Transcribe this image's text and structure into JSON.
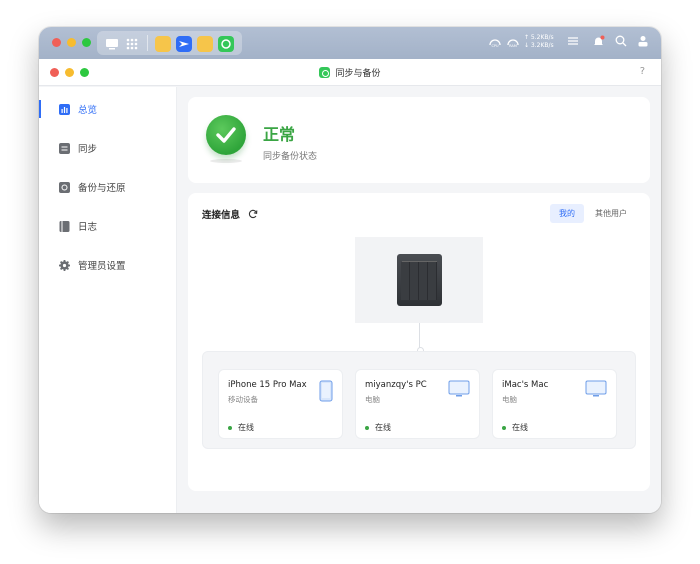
{
  "window": {
    "title": "同步与备份",
    "help": "?"
  },
  "systembar": {
    "net_up": "↑ 5.2KB/s",
    "net_down": "↓ 3.2KB/s",
    "cpu_label": "CPU",
    "ram_label": "RAM"
  },
  "sidebar": {
    "items": [
      {
        "label": "总览",
        "icon": "overview-icon",
        "active": true
      },
      {
        "label": "同步",
        "icon": "sync-icon",
        "active": false
      },
      {
        "label": "备份与还原",
        "icon": "backup-restore-icon",
        "active": false
      },
      {
        "label": "日志",
        "icon": "log-icon",
        "active": false
      },
      {
        "label": "管理员设置",
        "icon": "gear-icon",
        "active": false
      }
    ]
  },
  "status": {
    "title": "正常",
    "subtitle": "同步备份状态"
  },
  "connection": {
    "title": "连接信息",
    "tabs": [
      {
        "label": "我的",
        "active": true
      },
      {
        "label": "其他用户",
        "active": false
      }
    ],
    "devices": [
      {
        "name": "iPhone 15 Pro Max",
        "type": "移动设备",
        "status": "在线",
        "icon": "phone-icon"
      },
      {
        "name": "miyanzqy's PC",
        "type": "电脑",
        "status": "在线",
        "icon": "monitor-icon"
      },
      {
        "name": "iMac's Mac",
        "type": "电脑",
        "status": "在线",
        "icon": "monitor-icon"
      }
    ]
  },
  "colors": {
    "accent": "#2f6df6",
    "success": "#3aa544"
  }
}
